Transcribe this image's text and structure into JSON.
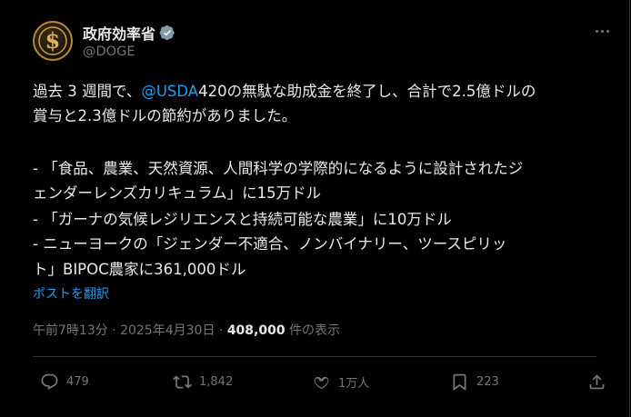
{
  "author": {
    "display_name": "政府効率省",
    "handle": "@DOGE",
    "avatar_symbol": "$",
    "verified_icon": "verified-badge-icon"
  },
  "post": {
    "line1_prefix": "過去 3 週間で、",
    "mention": "@USDA",
    "line1_suffix": "420の無駄な助成金を終了し、合計で2.5億ドルの",
    "line2": "賞与と2.3億ドルの節約がありました。",
    "line3": "- 「食品、農業、天然資源、人間科学の学際的になるように設計されたジ",
    "line4": "ェンダーレンズカリキュラム」に15万ドル",
    "line5": "- 「ガーナの気候レジリエンスと持続可能な農業」に10万ドル",
    "line6": "- ニューヨークの「ジェンダー不適合、ノンバイナリー、ツースピリッ",
    "line7": "ト」BIPOC農家に361,000ドル"
  },
  "translate_label": "ポストを翻訳",
  "meta": {
    "time": "午前7時13分",
    "separator": " · ",
    "date": "2025年4月30日",
    "views": "408,000",
    "views_suffix": " 件の表示"
  },
  "actions": {
    "replies": "479",
    "reposts": "1,842",
    "likes": "1万人",
    "bookmarks": "223"
  },
  "colors": {
    "accent": "#1d9bf0",
    "muted": "#71767b",
    "text": "#e7e9ea",
    "background": "#000000"
  }
}
